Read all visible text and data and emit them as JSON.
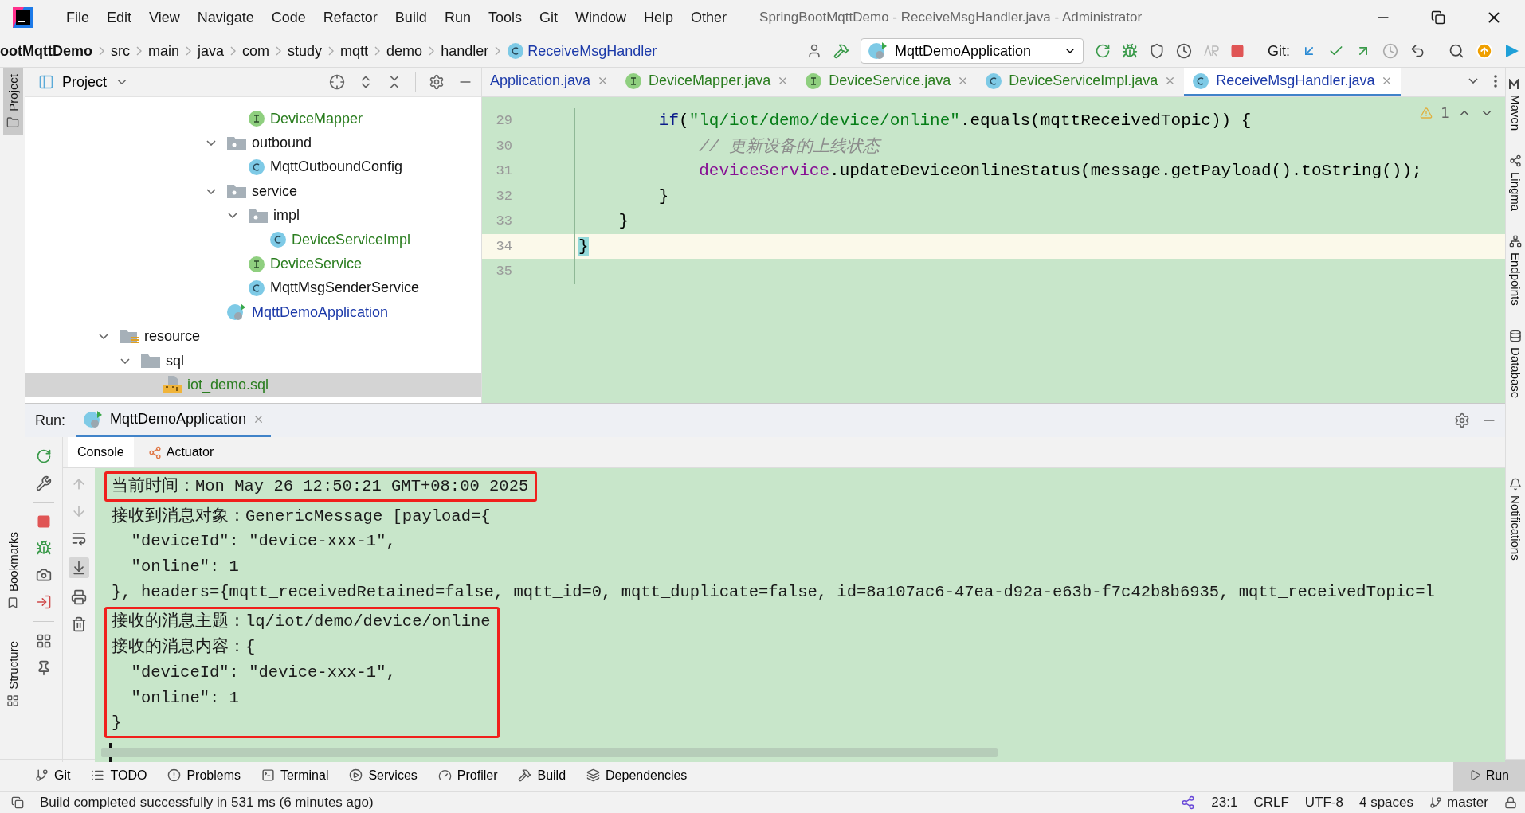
{
  "window": {
    "title": "SpringBootMqttDemo - ReceiveMsgHandler.java - Administrator"
  },
  "menu": [
    "File",
    "Edit",
    "View",
    "Navigate",
    "Code",
    "Refactor",
    "Build",
    "Run",
    "Tools",
    "Git",
    "Window",
    "Help",
    "Other"
  ],
  "breadcrumbs": [
    {
      "label": "ootMqttDemo",
      "kind": "project"
    },
    {
      "label": "src",
      "kind": "folder"
    },
    {
      "label": "main",
      "kind": "folder"
    },
    {
      "label": "java",
      "kind": "folder"
    },
    {
      "label": "com",
      "kind": "folder"
    },
    {
      "label": "study",
      "kind": "folder"
    },
    {
      "label": "mqtt",
      "kind": "folder"
    },
    {
      "label": "demo",
      "kind": "folder"
    },
    {
      "label": "handler",
      "kind": "folder"
    },
    {
      "label": "ReceiveMsgHandler",
      "kind": "class"
    }
  ],
  "run_config": {
    "label": "MqttDemoApplication"
  },
  "toolbar": {
    "git_label": "Git:"
  },
  "left_stripe": [
    {
      "label": "Project",
      "selected": true
    },
    {
      "label": "Bookmarks",
      "selected": false
    },
    {
      "label": "Structure",
      "selected": false
    }
  ],
  "right_stripe": [
    {
      "label": "Maven",
      "kind": "maven"
    },
    {
      "label": "Lingma",
      "kind": "lingma"
    },
    {
      "label": "Endpoints",
      "kind": "endpoints"
    },
    {
      "label": "Database",
      "kind": "database"
    },
    {
      "label": "Notifications",
      "kind": "notifications"
    }
  ],
  "project_panel": {
    "title": "Project",
    "tree": [
      {
        "children": [
          {
            "children": [
              {
                "children": [
                  {
                    "children": [
                      {
                        "children": [
                          {
                            "children": [
                              {
                                "label": "DeviceMapper",
                                "kind": "interface",
                                "color": "#2a7d1f",
                                "selected": false
                              }
                            ]
                          },
                          {
                            "label": "outbound",
                            "kind": "package",
                            "color": "#111111",
                            "expanded": true,
                            "selected": false,
                            "children": [
                              {
                                "label": "MqttOutboundConfig",
                                "kind": "class",
                                "color": "#111111",
                                "selected": false
                              }
                            ]
                          },
                          {
                            "label": "service",
                            "kind": "package",
                            "color": "#111111",
                            "expanded": true,
                            "selected": false,
                            "children": [
                              {
                                "label": "impl",
                                "kind": "package",
                                "color": "#111111",
                                "expanded": true,
                                "selected": false,
                                "children": [
                                  {
                                    "label": "DeviceServiceImpl",
                                    "kind": "class",
                                    "color": "#2a7d1f",
                                    "selected": false
                                  }
                                ]
                              },
                              {
                                "label": "DeviceService",
                                "kind": "interface",
                                "color": "#2a7d1f",
                                "selected": false
                              },
                              {
                                "label": "MqttMsgSenderService",
                                "kind": "class",
                                "color": "#111111",
                                "selected": false
                              }
                            ]
                          },
                          {
                            "label": "MqttDemoApplication",
                            "kind": "spring-app",
                            "color": "#1c3aa9",
                            "selected": false
                          }
                        ]
                      }
                    ]
                  }
                ]
              }
            ]
          }
        ]
      },
      {
        "label": "resource",
        "kind": "resources",
        "color": "#111111",
        "expanded": true,
        "selected": false,
        "children": [
          {
            "label": "sql",
            "kind": "folder",
            "color": "#111111",
            "expanded": true,
            "selected": false,
            "children": [
              {
                "label": "iot_demo.sql",
                "kind": "sql-file",
                "color": "#2a7d1f",
                "selected": true
              }
            ]
          }
        ]
      }
    ]
  },
  "editor": {
    "tabs": [
      {
        "label": "Application.java",
        "kind": "none",
        "color": "#1c3aa9",
        "selected": false
      },
      {
        "label": "DeviceMapper.java",
        "kind": "interface",
        "color": "#2a7d1f",
        "selected": false
      },
      {
        "label": "DeviceService.java",
        "kind": "interface",
        "color": "#2a7d1f",
        "selected": false
      },
      {
        "label": "DeviceServiceImpl.java",
        "kind": "class",
        "color": "#2a7d1f",
        "selected": false
      },
      {
        "label": "ReceiveMsgHandler.java",
        "kind": "class",
        "color": "#1c3aa9",
        "selected": true
      }
    ],
    "warning_count": "1",
    "lines": [
      {
        "number": "29",
        "current": false,
        "tokens": [
          {
            "text": "        if",
            "kind": "keyword"
          },
          {
            "text": "(",
            "kind": "plain"
          },
          {
            "text": "\"lq/iot/demo/device/online\"",
            "kind": "string"
          },
          {
            "text": ".equals(mqttReceivedTopic)) {",
            "kind": "plain"
          }
        ]
      },
      {
        "number": "30",
        "current": false,
        "tokens": [
          {
            "text": "            // 更新设备的上线状态",
            "kind": "comment"
          }
        ]
      },
      {
        "number": "31",
        "current": false,
        "tokens": [
          {
            "text": "            deviceService",
            "kind": "field"
          },
          {
            "text": ".updateDeviceOnlineStatus(message.getPayload().toString());",
            "kind": "plain"
          }
        ]
      },
      {
        "number": "32",
        "current": false,
        "tokens": [
          {
            "text": "        }",
            "kind": "plain"
          }
        ]
      },
      {
        "number": "33",
        "current": false,
        "tokens": [
          {
            "text": "    }",
            "kind": "plain"
          }
        ]
      },
      {
        "number": "34",
        "current": true,
        "tokens": [
          {
            "text": "}",
            "kind": "brace-match"
          }
        ]
      },
      {
        "number": "35",
        "current": false
      }
    ]
  },
  "run_panel": {
    "label": "Run:",
    "tab": "MqttDemoApplication",
    "subtabs": [
      {
        "label": "Console",
        "kind": "console",
        "selected": true
      },
      {
        "label": "Actuator",
        "kind": "actuator",
        "selected": false
      }
    ],
    "console": [
      {
        "highlighted": true,
        "lines": [
          "当前时间：Mon May 26 12:50:21 GMT+08:00 2025"
        ]
      },
      {
        "highlighted": false,
        "lines": [
          "接收到消息对象：GenericMessage [payload={",
          "  \"deviceId\": \"device-xxx-1\",",
          "  \"online\": 1",
          "}, headers={mqtt_receivedRetained=false, mqtt_id=0, mqtt_duplicate=false, id=8a107ac6-47ea-d92a-e63b-f7c42b8b6935, mqtt_receivedTopic=l"
        ]
      },
      {
        "highlighted": true,
        "lines": [
          "接收的消息主题：lq/iot/demo/device/online",
          "接收的消息内容：{",
          "  \"deviceId\": \"device-xxx-1\",",
          "  \"online\": 1",
          "}"
        ]
      }
    ]
  },
  "tool_windows": [
    {
      "label": "Git",
      "kind": "git"
    },
    {
      "label": "TODO",
      "kind": "todo"
    },
    {
      "label": "Problems",
      "kind": "problems"
    },
    {
      "label": "Terminal",
      "kind": "terminal"
    },
    {
      "label": "Services",
      "kind": "services"
    },
    {
      "label": "Profiler",
      "kind": "profiler"
    },
    {
      "label": "Build",
      "kind": "build"
    },
    {
      "label": "Dependencies",
      "kind": "dependencies"
    }
  ],
  "run_button": {
    "label": "Run",
    "selected": true
  },
  "status_bar": {
    "message": "Build completed successfully in 531 ms (6 minutes ago)",
    "position": "23:1",
    "line_separator": "CRLF",
    "encoding": "UTF-8",
    "indent": "4 spaces",
    "branch": "master"
  }
}
